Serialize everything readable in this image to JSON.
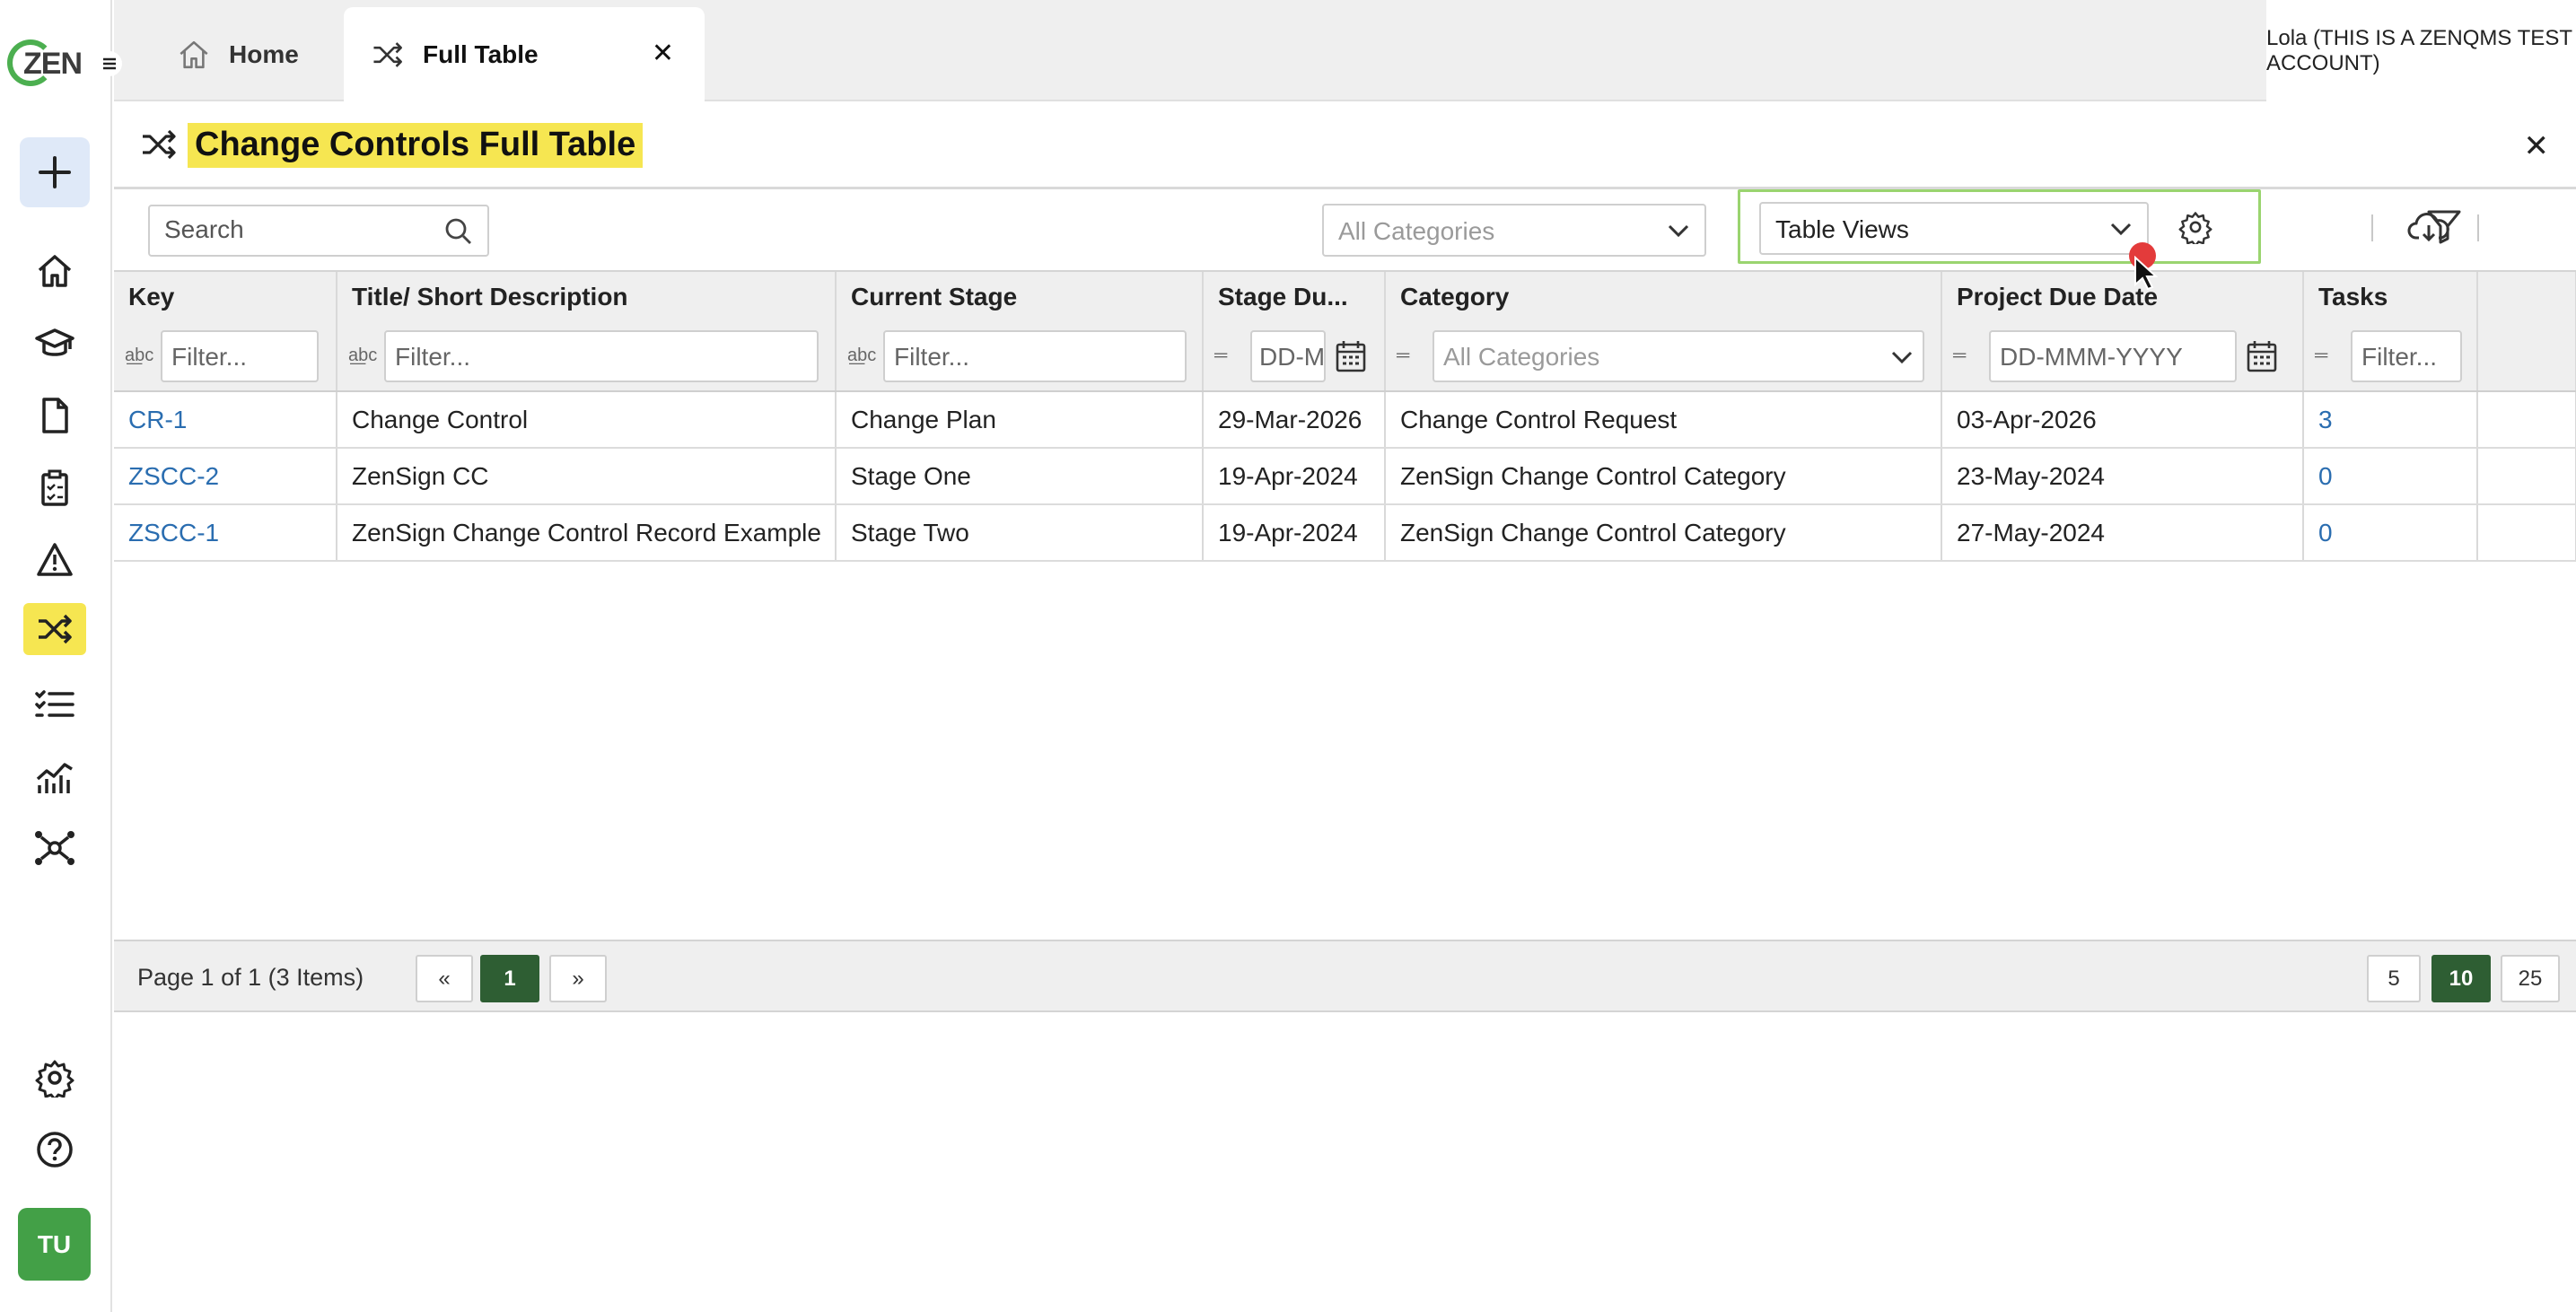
{
  "logo": {
    "text": "ZEN"
  },
  "user": {
    "initials": "TU"
  },
  "tabs": [
    {
      "label": "Home",
      "icon": "home-icon"
    },
    {
      "label": "Full Table",
      "icon": "shuffle-icon"
    }
  ],
  "account": {
    "label": "Lola (THIS IS A ZENQMS TEST ACCOUNT)"
  },
  "page": {
    "title": "Change Controls Full Table"
  },
  "toolbar": {
    "search_placeholder": "Search",
    "category_select": "All Categories",
    "views_select": "Table Views"
  },
  "table": {
    "columns": [
      "Key",
      "Title/ Short Description",
      "Current Stage",
      "Stage Du...",
      "Category",
      "Project Due Date",
      "Tasks"
    ],
    "filters": {
      "text_placeholder": "Filter...",
      "date_short": "DD-M",
      "date_placeholder": "DD-MMM-YYYY",
      "category_placeholder": "All Categories"
    },
    "rows": [
      {
        "key": "CR-1",
        "title": "Change Control",
        "stage": "Change Plan",
        "stage_due": "29-Mar-2026",
        "category": "Change Control Request",
        "project_due": "03-Apr-2026",
        "tasks": "3"
      },
      {
        "key": "ZSCC-2",
        "title": "ZenSign CC",
        "stage": "Stage One",
        "stage_due": "19-Apr-2024",
        "category": "ZenSign Change Control Category",
        "project_due": "23-May-2024",
        "tasks": "0"
      },
      {
        "key": "ZSCC-1",
        "title": "ZenSign Change Control Record Example",
        "stage": "Stage Two",
        "stage_due": "19-Apr-2024",
        "category": "ZenSign Change Control Category",
        "project_due": "27-May-2024",
        "tasks": "0"
      }
    ]
  },
  "pager": {
    "info": "Page 1 of 1 (3 Items)",
    "first": "«",
    "current": "1",
    "last": "»",
    "sizes": [
      "5",
      "10",
      "25"
    ]
  },
  "colors": {
    "accent_yellow": "#f6e651",
    "active_green": "#2e5e33",
    "link_blue": "#2a6db0",
    "avatar_green": "#43a047",
    "highlight_box": "#9ad46f"
  }
}
